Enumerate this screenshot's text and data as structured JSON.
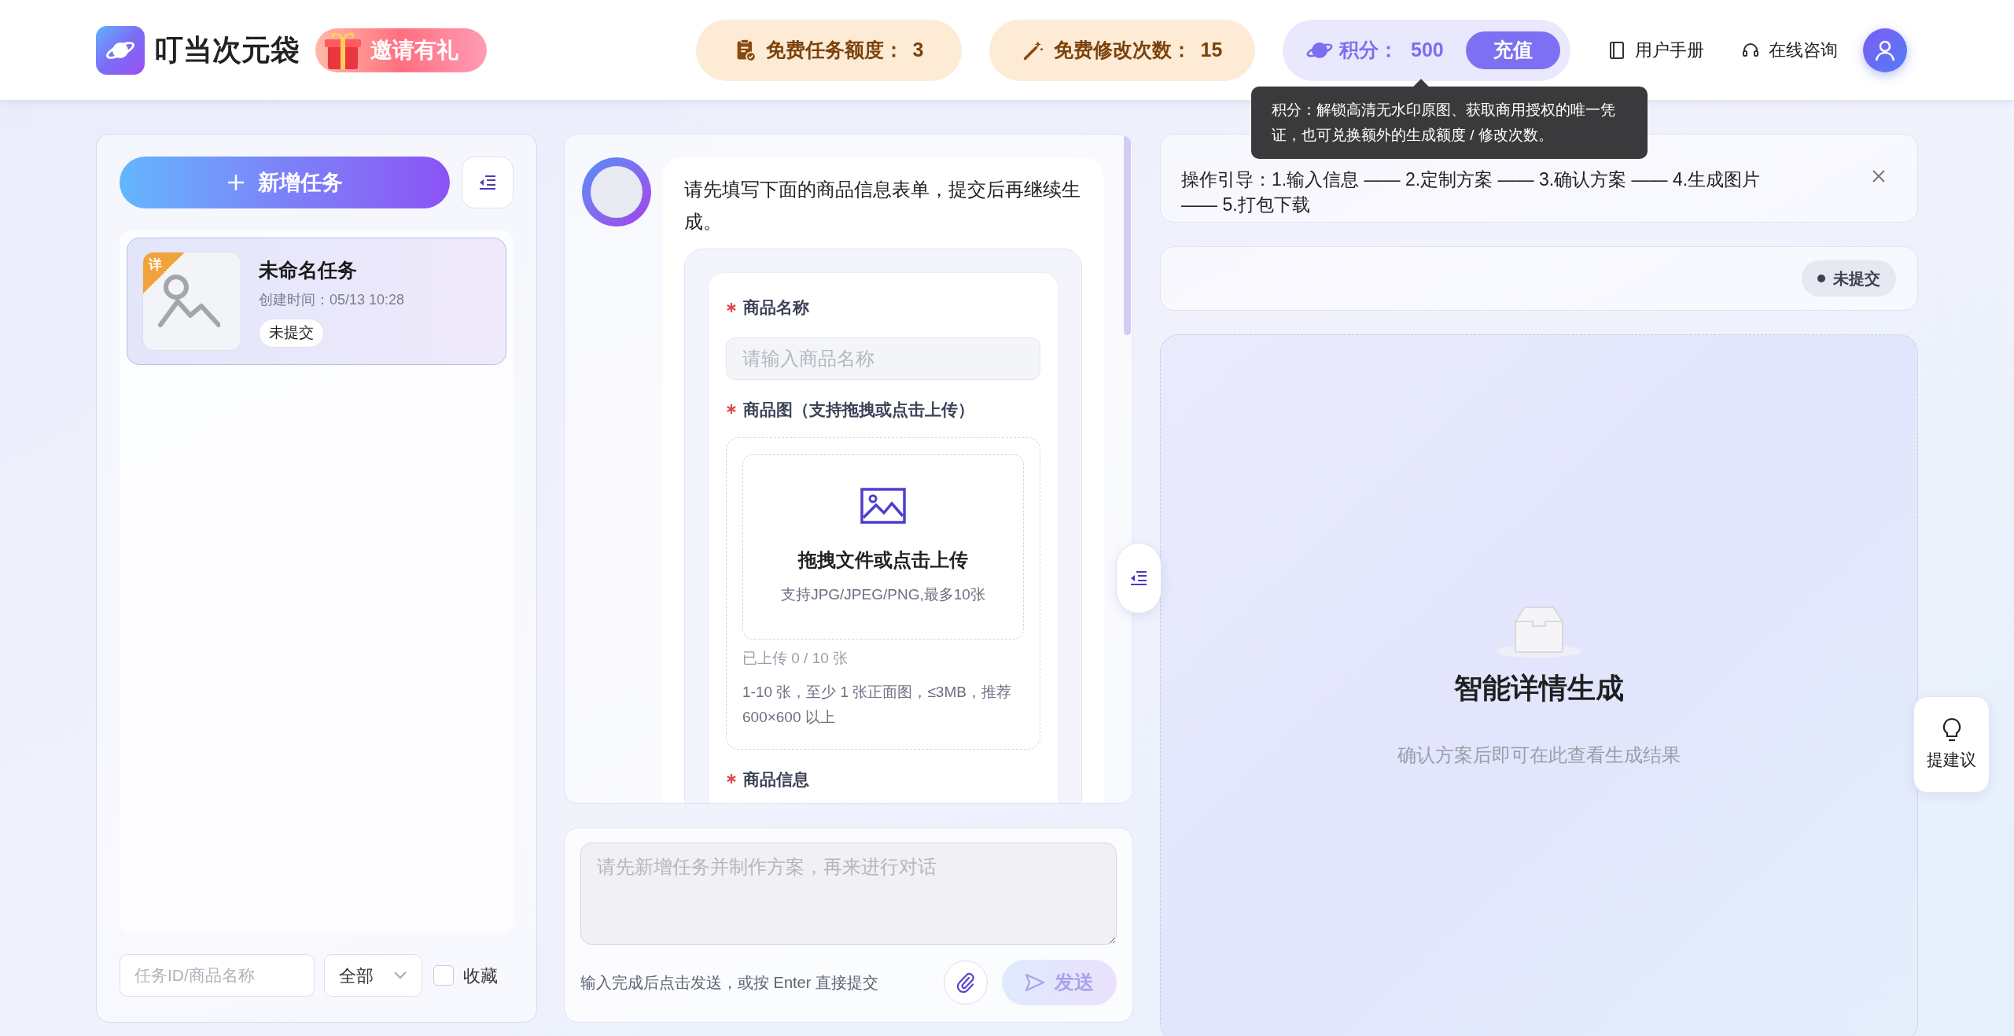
{
  "header": {
    "logo_text": "叮当次元袋",
    "invite_banner": "邀请有礼",
    "quotas": [
      {
        "kind": "task",
        "label": "免费任务额度：",
        "value": "3"
      },
      {
        "kind": "edit",
        "label": "免费修改次数：",
        "value": "15"
      }
    ],
    "points": {
      "label": "积分：",
      "value": "500",
      "button": "充值"
    },
    "links": [
      {
        "kind": "manual",
        "label": "用户手册"
      },
      {
        "kind": "consult",
        "label": "在线咨询"
      }
    ]
  },
  "tooltip": {
    "text": "积分：解锁高清无水印原图、获取商用授权的唯一凭证，也可兑换额外的生成额度 / 修改次数。"
  },
  "task_panel": {
    "new_task_button": "新增任务",
    "tasks": [
      {
        "corner_badge": "详",
        "title": "未命名任务",
        "created": "创建时间：05/13 10:28",
        "status": "未提交",
        "selected": true
      }
    ],
    "search": {
      "placeholder": "任务ID/商品名称"
    },
    "filter": {
      "value": "全部"
    },
    "favorite": {
      "label": "收藏",
      "checked": false
    }
  },
  "chat": {
    "message": "请先填写下面的商品信息表单，提交后再继续生成。",
    "fields": [
      {
        "kind": "text",
        "label": "商品名称",
        "required": true,
        "placeholder": "请输入商品名称"
      },
      {
        "kind": "upload",
        "label": "商品图（支持拖拽或点击上传）",
        "required": true,
        "title": "拖拽文件或点击上传",
        "hint": "支持JPG/JPEG/PNG,最多10张",
        "count": "已上传 0 / 10 张",
        "note": "1-10 张，至少 1 张正面图，≤3MB，推荐 600×600 以上"
      },
      {
        "kind": "label",
        "label": "商品信息",
        "required": true
      }
    ]
  },
  "composer": {
    "placeholder": "请先新增任务并制作方案，再来进行对话",
    "disabled": true,
    "hint": "输入完成后点击发送，或按 Enter 直接提交",
    "send_button": "发送"
  },
  "guide": {
    "text": "操作引导：1.输入信息 —— 2.定制方案 —— 3.确认方案 —— 4.生成图片 —— 5.打包下载"
  },
  "status": {
    "label": "未提交"
  },
  "result": {
    "title": "智能详情生成",
    "subtitle": "确认方案后即可在此查看生成结果"
  },
  "suggest_button": "提建议"
}
